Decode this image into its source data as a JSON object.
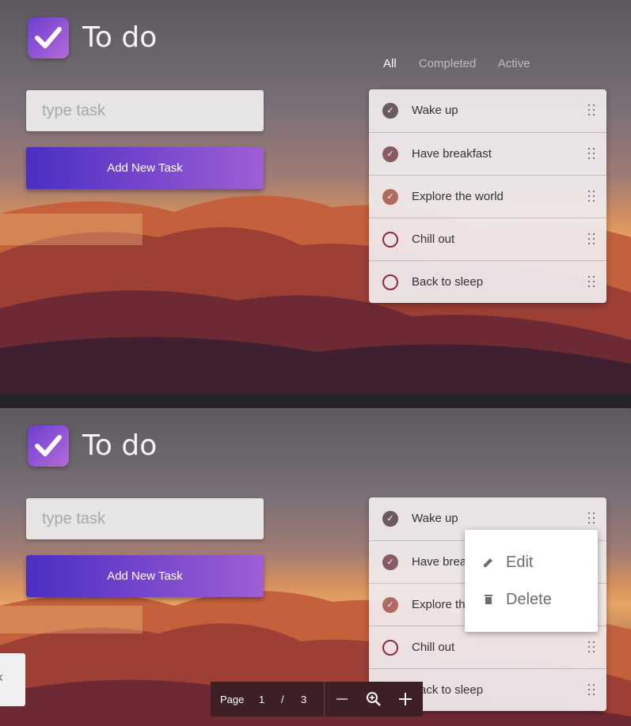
{
  "app": {
    "title": "To do",
    "logo_icon": "checkbox-check-icon"
  },
  "filters": [
    {
      "label": "All",
      "active": true
    },
    {
      "label": "Completed",
      "active": false
    },
    {
      "label": "Active",
      "active": false
    }
  ],
  "input": {
    "placeholder": "type task",
    "value": ""
  },
  "add_button": {
    "label": "Add New Task"
  },
  "tasks": [
    {
      "label": "Wake up",
      "completed": true,
      "check_color": "#6b5a60"
    },
    {
      "label": "Have breakfast",
      "completed": true,
      "check_color": "#8a5a62"
    },
    {
      "label": "Explore the world",
      "completed": true,
      "check_color": "#b06a60"
    },
    {
      "label": "Chill out",
      "completed": false,
      "check_color": "#8c2c3a"
    },
    {
      "label": "Back to sleep",
      "completed": false,
      "check_color": "#8c2c3a"
    }
  ],
  "context_menu": {
    "items": [
      {
        "label": "Edit",
        "icon": "pencil-icon"
      },
      {
        "label": "Delete",
        "icon": "trash-icon"
      }
    ]
  },
  "side_tab": {
    "glyph": "‹",
    "icon": "chevron-left-icon"
  },
  "pager": {
    "page_label": "Page",
    "current": "1",
    "separator": "/",
    "total": "3",
    "zoom_out_icon": "minus-icon",
    "zoom_icon": "zoom-in-icon",
    "zoom_in_icon": "plus-icon"
  },
  "colors": {
    "accent_start": "#4a2fc2",
    "accent_end": "#a05ed6"
  }
}
